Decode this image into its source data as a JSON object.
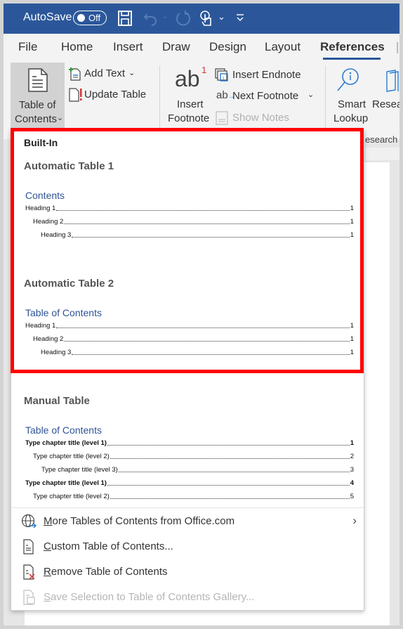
{
  "titlebar": {
    "autosave_label": "AutoSave",
    "autosave_state": "Off",
    "icons": [
      "save-icon",
      "undo-icon",
      "redo-icon",
      "touch-mode-icon",
      "customize-qat-icon"
    ]
  },
  "tabs": [
    {
      "label": "File"
    },
    {
      "label": "Home"
    },
    {
      "label": "Insert"
    },
    {
      "label": "Draw"
    },
    {
      "label": "Design"
    },
    {
      "label": "Layout"
    },
    {
      "label": "References",
      "active": true
    }
  ],
  "ribbon": {
    "toc": {
      "line1": "Table of",
      "line2": "Contents"
    },
    "add_text": "Add Text",
    "update_table": "Update Table",
    "insert_footnote": {
      "line1": "Insert",
      "line2": "Footnote"
    },
    "insert_endnote": "Insert Endnote",
    "next_footnote": "Next Footnote",
    "show_notes": "Show Notes",
    "smart_lookup": {
      "line1": "Smart",
      "line2": "Lookup"
    },
    "researcher": "Resea",
    "group_research": "esearch"
  },
  "dropdown": {
    "section": "Built-In",
    "galleries": [
      {
        "title": "Automatic Table 1",
        "heading": "Contents",
        "entries": [
          {
            "text": "Heading 1",
            "page": "1",
            "level": 1,
            "bold": false
          },
          {
            "text": "Heading 2",
            "page": "1",
            "level": 2,
            "bold": false
          },
          {
            "text": "Heading 3",
            "page": "1",
            "level": 3,
            "bold": false
          }
        ]
      },
      {
        "title": "Automatic Table 2",
        "heading": "Table of Contents",
        "entries": [
          {
            "text": "Heading 1",
            "page": "1",
            "level": 1,
            "bold": false
          },
          {
            "text": "Heading 2",
            "page": "1",
            "level": 2,
            "bold": false
          },
          {
            "text": "Heading 3",
            "page": "1",
            "level": 3,
            "bold": false
          }
        ]
      },
      {
        "title": "Manual Table",
        "heading": "Table of Contents",
        "entries": [
          {
            "text": "Type chapter title (level 1)",
            "page": "1",
            "level": 1,
            "bold": true
          },
          {
            "text": "Type chapter title (level 2)",
            "page": "2",
            "level": 2,
            "bold": false
          },
          {
            "text": "Type chapter title (level 3)",
            "page": "3",
            "level": 3,
            "bold": false
          },
          {
            "text": "Type chapter title (level 1)",
            "page": "4",
            "level": 1,
            "bold": true
          },
          {
            "text": "Type chapter title (level 2)",
            "page": "5",
            "level": 2,
            "bold": false
          }
        ]
      }
    ],
    "menu": [
      {
        "key": "M",
        "rest": "ore Tables of Contents from Office.com",
        "icon": "globe-icon",
        "submenu": true,
        "disabled": false
      },
      {
        "key": "C",
        "rest": "ustom Table of Contents...",
        "icon": "custom-toc-icon",
        "submenu": false,
        "disabled": false
      },
      {
        "key": "R",
        "rest": "emove Table of Contents",
        "icon": "remove-toc-icon",
        "submenu": false,
        "disabled": false
      },
      {
        "key": "S",
        "rest": "ave Selection to Table of Contents Gallery...",
        "icon": "save-selection-icon",
        "submenu": false,
        "disabled": true
      }
    ]
  },
  "colors": {
    "titlebar": "#2b579a",
    "highlight": "#ff0000",
    "toc_heading": "#2f5496"
  }
}
